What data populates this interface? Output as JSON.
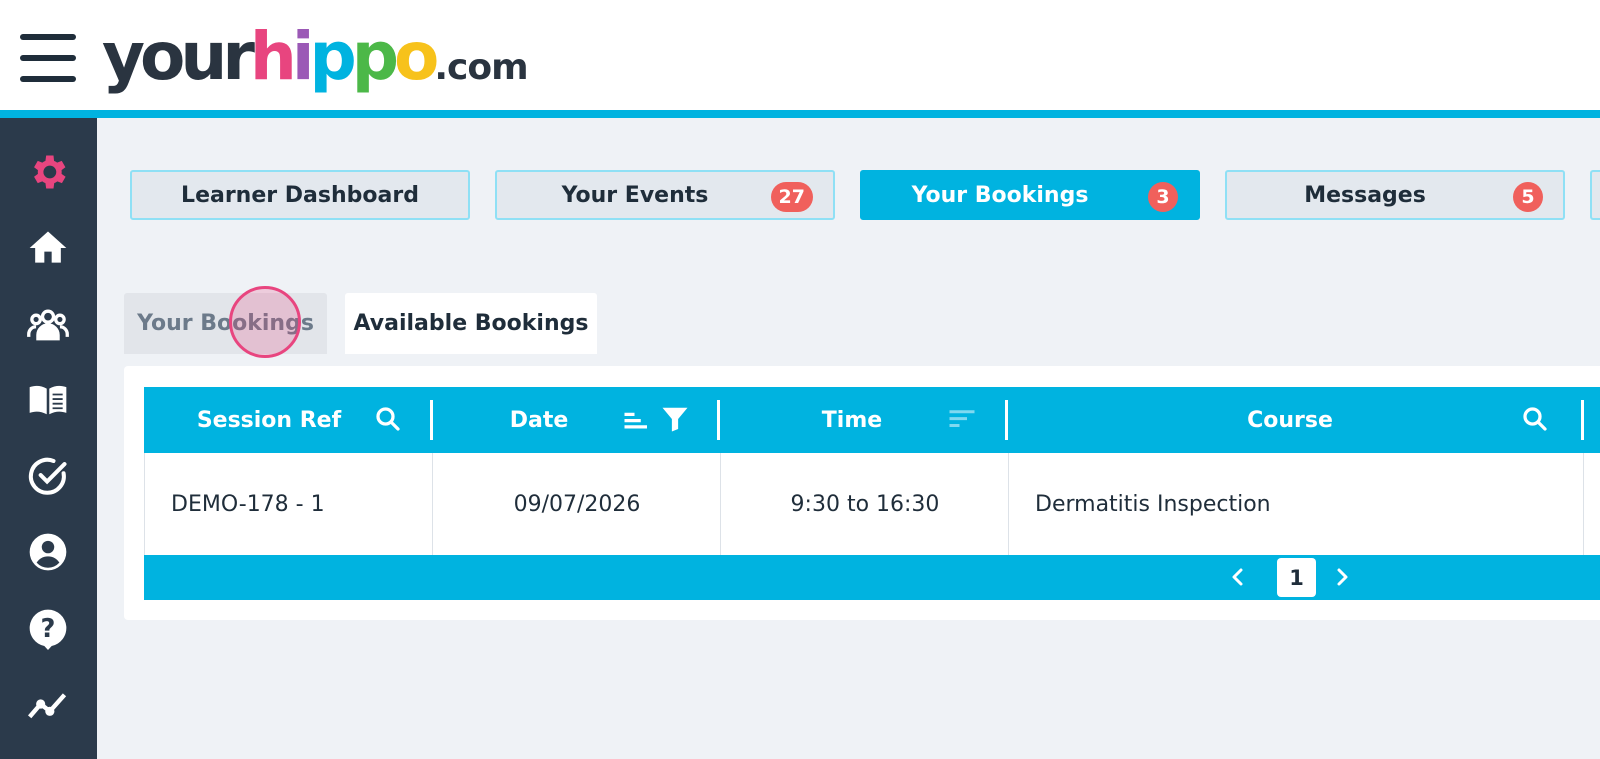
{
  "header": {
    "menu_icon": "hamburger-menu-icon",
    "logo": {
      "parts": [
        {
          "text": "your",
          "color": "#2a3440"
        },
        {
          "text": "h",
          "color": "#e8457f"
        },
        {
          "text": "i",
          "color": "#9b59b6"
        },
        {
          "text": "p",
          "color": "#00b3e0"
        },
        {
          "text": "p",
          "color": "#4cb848"
        },
        {
          "text": "o",
          "color": "#f7c21b"
        }
      ],
      "suffix": ".com"
    },
    "accent_color": "#00b3e0"
  },
  "sidebar": {
    "background": "#2b3a4b",
    "icons": [
      "gear-icon",
      "home-icon",
      "group-icon",
      "book-icon",
      "check-circle-icon",
      "user-circle-icon",
      "help-bubble-icon",
      "chart-line-icon"
    ],
    "active_icon_color": "#e8457f"
  },
  "nav_tabs": [
    {
      "label": "Learner Dashboard",
      "count": "",
      "active": false
    },
    {
      "label": "Your Events",
      "count": "27",
      "active": false
    },
    {
      "label": "Your Bookings",
      "count": "3",
      "active": true
    },
    {
      "label": "Messages",
      "count": "5",
      "active": false
    }
  ],
  "sub_tabs": {
    "your_bookings": "Your Bookings",
    "available_bookings": "Available Bookings"
  },
  "table": {
    "columns": [
      {
        "label": "Session Ref",
        "icon": "search-icon"
      },
      {
        "label": "Date",
        "icon": "sort-filter-icon"
      },
      {
        "label": "Time",
        "icon": "sort-icon"
      },
      {
        "label": "Course",
        "icon": "search-icon"
      }
    ],
    "rows": [
      {
        "session_ref": "DEMO-178 - 1",
        "date": "09/07/2026",
        "time": "9:30 to 16:30",
        "course": "Dermatitis Inspection"
      }
    ]
  },
  "pagination": {
    "current_page": "1",
    "prev_icon": "chevron-left-icon",
    "next_icon": "chevron-right-icon"
  }
}
